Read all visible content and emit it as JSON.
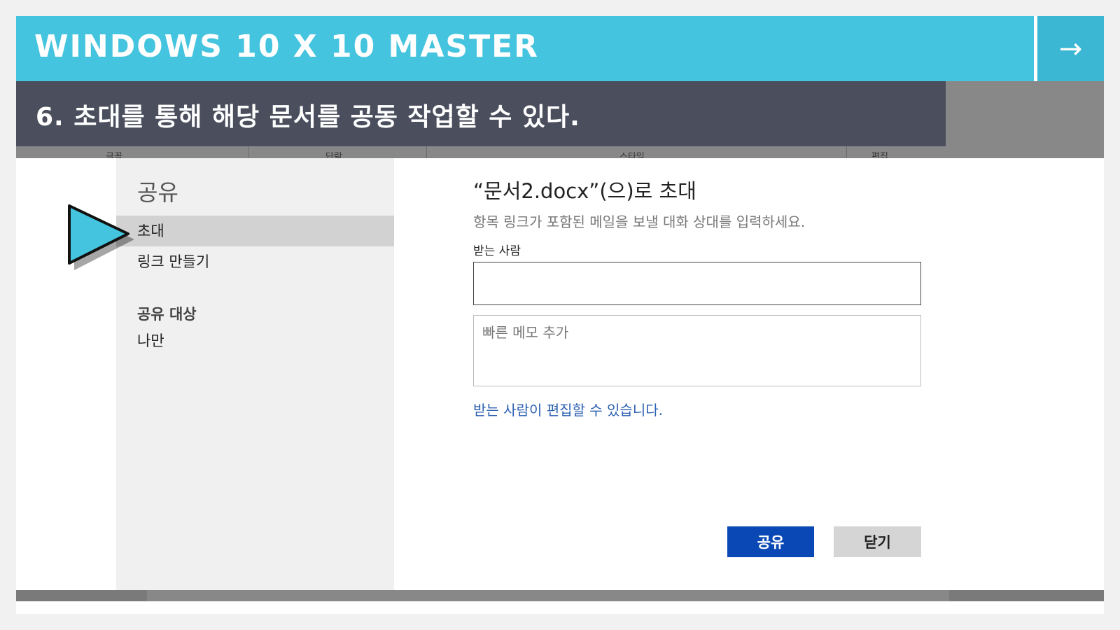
{
  "banner": {
    "title": "WINDOWS 10 X 10 MASTER",
    "next_icon": "arrow-right-icon",
    "next_glyph": "→",
    "color": "#44c4de"
  },
  "subtitle": {
    "text": "6. 초대를 통해 해당 문서를 공동 작업할 수 있다.",
    "color": "#4a4e5d"
  },
  "ribbon": {
    "labels": [
      "글꼴",
      "단락",
      "스타일",
      "편집"
    ]
  },
  "nav": {
    "heading": "공유",
    "items": [
      {
        "label": "초대",
        "active": true
      },
      {
        "label": "링크 만들기",
        "active": false
      }
    ],
    "section_title": "공유 대상",
    "section_value": "나만"
  },
  "dialog": {
    "title": "“문서2.docx”(으)로 초대",
    "description": "항목 링크가 포함된 메일을 보낼 대화 상대를 입력하세요.",
    "to_label": "받는 사람",
    "to_value": "",
    "memo_placeholder": "빠른 메모 추가",
    "permission_link": "받는 사람이 편집할 수 있습니다.",
    "share_button": "공유",
    "close_button": "닫기",
    "accent": "#0a48b5"
  },
  "pointer": {
    "icon": "play-triangle-icon",
    "color": "#44c4de"
  }
}
